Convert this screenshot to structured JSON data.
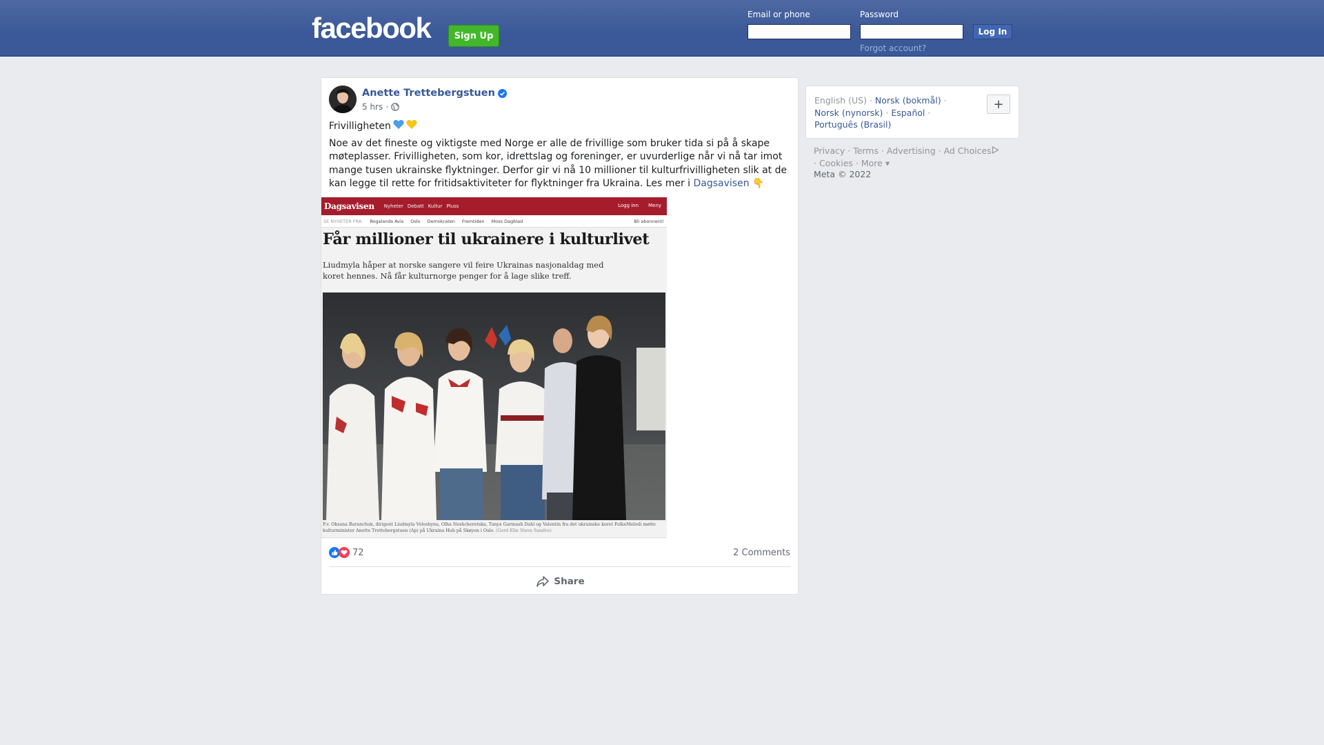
{
  "header": {
    "logo": "facebook",
    "signup_label": "Sign Up",
    "email_label": "Email or phone",
    "email_value": "",
    "password_label": "Password",
    "password_value": "",
    "login_label": "Log In",
    "forgot_label": "Forgot account?"
  },
  "post": {
    "author": "Anette Trettebergstuen",
    "time": "5 hrs",
    "title": "Frivilligheten",
    "title_emoji": [
      "blue-heart",
      "yellow-heart"
    ],
    "body": "Noe av det fineste og viktigste med Norge er alle de frivillige som bruker tida si på å skape møteplasser. Frivilligheten, som kor, idrettslag og foreninger, er uvurderlige når vi nå tar imot mange tusen ukrainske flyktninger. Derfor gir vi nå 10 millioner til kulturfrivilligheten slik at de kan legge til rette for fritidsaktiviteter for flyktninger fra Ukraina. Les mer i ",
    "link_text": "Dagsavisen",
    "link_emoji": "👇",
    "article": {
      "site_logo": "Dagsavisen",
      "nav_items": [
        "Nyheter",
        "Debatt",
        "Kultur",
        "Pluss"
      ],
      "nav_right": [
        "Logg inn",
        "Meny"
      ],
      "sub_prefix": "SE NYHETER FRA:",
      "sub_items": [
        "Rogalands Avis",
        "Oslo",
        "Demokraten",
        "Fremtiden",
        "Moss Dagblad"
      ],
      "sub_right": "Bli abonnent!",
      "headline": "Får millioner til ukrainere i kulturlivet",
      "lead": "Liudmyla håper at norske sangere vil feire Ukrainas nasjonaldag med koret hennes. Nå får kulturnorge penger for å lage slike treff.",
      "caption": "F.v. Oksana Baranchuk, dirigent Liudmyla Voloshyna, Olha Neshcheretska, Tanya Garmash Dahl og Valentin fra det ukrainske koret FolkeMelodi møtte kulturminister Anette Trettebergstuen (Ap) på Ukraina Hub på Skøyen i Oslo.",
      "credit": "(Gerd Elin Stava Sandve)"
    },
    "reactions_count": "72",
    "comments_label": "2 Comments",
    "share_label": "Share"
  },
  "sidebar": {
    "languages": [
      {
        "label": "English (US)",
        "current": true
      },
      {
        "label": "Norsk (bokmål)",
        "current": false
      },
      {
        "label": "Norsk (nynorsk)",
        "current": false
      },
      {
        "label": "Español",
        "current": false
      },
      {
        "label": "Português (Brasil)",
        "current": false
      }
    ],
    "add_language": "+",
    "footer_links": [
      "Privacy",
      "Terms",
      "Advertising",
      "Ad Choices",
      "Cookies",
      "More"
    ],
    "copyright": "Meta © 2022"
  },
  "colors": {
    "brand": "#3b5998",
    "link": "#385898",
    "signup_green": "#42b72a",
    "background": "#e9ebee",
    "dagsavisen_red": "#a51d2d"
  }
}
